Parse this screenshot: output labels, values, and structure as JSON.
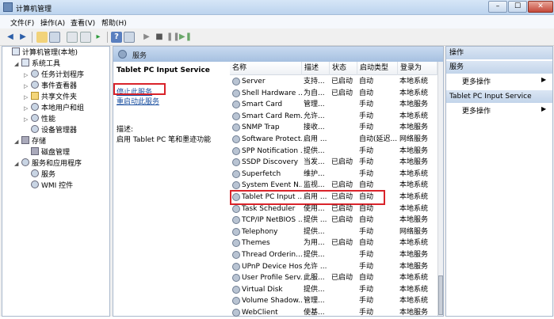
{
  "window": {
    "title": "计算机管理"
  },
  "menu": [
    "文件(F)",
    "操作(A)",
    "查看(V)",
    "帮助(H)"
  ],
  "tree": [
    {
      "label": "计算机管理(本地)",
      "indent": 0,
      "exp": "",
      "icon": "computer"
    },
    {
      "label": "系统工具",
      "indent": 1,
      "exp": "◢",
      "icon": "tools"
    },
    {
      "label": "任务计划程序",
      "indent": 2,
      "exp": "▷",
      "icon": "gear"
    },
    {
      "label": "事件查看器",
      "indent": 2,
      "exp": "▷",
      "icon": "gear"
    },
    {
      "label": "共享文件夹",
      "indent": 2,
      "exp": "▷",
      "icon": "folder"
    },
    {
      "label": "本地用户和组",
      "indent": 2,
      "exp": "▷",
      "icon": "gear"
    },
    {
      "label": "性能",
      "indent": 2,
      "exp": "▷",
      "icon": "gear"
    },
    {
      "label": "设备管理器",
      "indent": 2,
      "exp": "",
      "icon": "gear"
    },
    {
      "label": "存储",
      "indent": 1,
      "exp": "◢",
      "icon": "disk"
    },
    {
      "label": "磁盘管理",
      "indent": 2,
      "exp": "",
      "icon": "disk"
    },
    {
      "label": "服务和应用程序",
      "indent": 1,
      "exp": "◢",
      "icon": "gear"
    },
    {
      "label": "服务",
      "indent": 2,
      "exp": "",
      "icon": "gear"
    },
    {
      "label": "WMI 控件",
      "indent": 2,
      "exp": "",
      "icon": "gear"
    }
  ],
  "center": {
    "header": "服务",
    "selected_title": "Tablet PC Input Service",
    "stop_link": "停止此服务",
    "restart_link": "重启动此服务",
    "desc_label": "描述:",
    "desc_text": "启用 Tablet PC 笔和墨迹功能"
  },
  "columns": [
    "名称",
    "描述",
    "状态",
    "启动类型",
    "登录为"
  ],
  "services": [
    [
      "Server",
      "支持...",
      "已启动",
      "自动",
      "本地系统"
    ],
    [
      "Shell Hardware ...",
      "为自...",
      "已启动",
      "自动",
      "本地系统"
    ],
    [
      "Smart Card",
      "管理...",
      "",
      "手动",
      "本地服务"
    ],
    [
      "Smart Card Rem...",
      "允许...",
      "",
      "手动",
      "本地系统"
    ],
    [
      "SNMP Trap",
      "接收...",
      "",
      "手动",
      "本地服务"
    ],
    [
      "Software Protect...",
      "启用 ...",
      "",
      "自动(延迟...",
      "网络服务"
    ],
    [
      "SPP Notification ...",
      "提供...",
      "",
      "手动",
      "本地服务"
    ],
    [
      "SSDP Discovery",
      "当发...",
      "已启动",
      "手动",
      "本地服务"
    ],
    [
      "Superfetch",
      "维护...",
      "",
      "手动",
      "本地系统"
    ],
    [
      "System Event N...",
      "监视...",
      "已启动",
      "自动",
      "本地系统"
    ],
    [
      "Tablet PC Input ...",
      "启用 ...",
      "已启动",
      "自动",
      "本地系统"
    ],
    [
      "Task Scheduler",
      "使用...",
      "已启动",
      "自动",
      "本地系统"
    ],
    [
      "TCP/IP NetBIOS ...",
      "提供 ...",
      "已启动",
      "自动",
      "本地服务"
    ],
    [
      "Telephony",
      "提供...",
      "",
      "手动",
      "网络服务"
    ],
    [
      "Themes",
      "为用...",
      "已启动",
      "自动",
      "本地系统"
    ],
    [
      "Thread Orderin...",
      "提供...",
      "",
      "手动",
      "本地服务"
    ],
    [
      "UPnP Device Host",
      "允许 ...",
      "",
      "手动",
      "本地服务"
    ],
    [
      "User Profile Serv...",
      "此服...",
      "已启动",
      "自动",
      "本地系统"
    ],
    [
      "Virtual Disk",
      "提供...",
      "",
      "手动",
      "本地系统"
    ],
    [
      "Volume Shadow...",
      "管理...",
      "",
      "手动",
      "本地系统"
    ],
    [
      "WebClient",
      "使基...",
      "",
      "手动",
      "本地服务"
    ]
  ],
  "actions": {
    "head1": "操作",
    "head2": "服务",
    "more1": "更多操作",
    "head3": "Tablet PC Input Service",
    "more2": "更多操作"
  }
}
